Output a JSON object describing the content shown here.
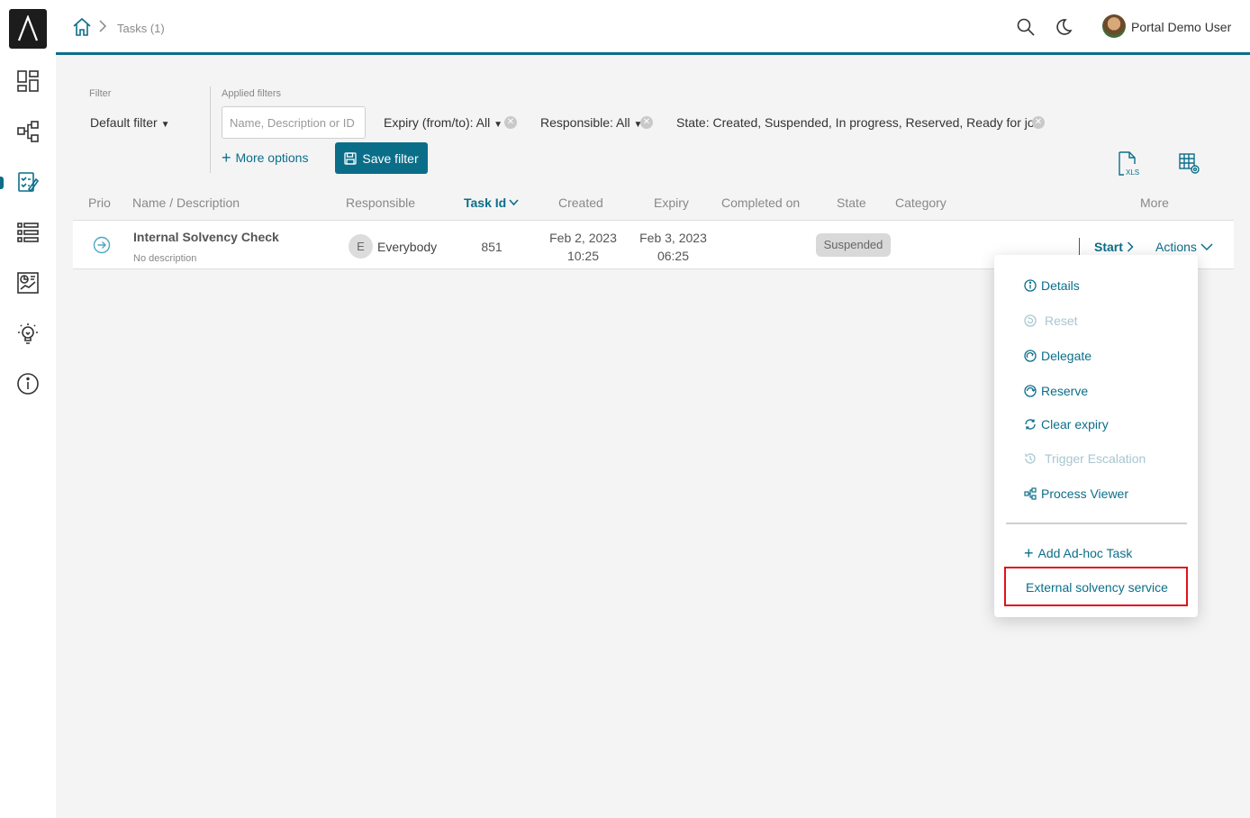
{
  "header": {
    "breadcrumb": "Tasks (1)",
    "user_name": "Portal Demo User"
  },
  "sidebar": {
    "items": [
      {
        "icon": "dashboard-icon"
      },
      {
        "icon": "process-icon"
      },
      {
        "icon": "tasks-icon",
        "active": true
      },
      {
        "icon": "list-icon"
      },
      {
        "icon": "statistics-icon"
      },
      {
        "icon": "lightbulb-icon"
      },
      {
        "icon": "info-icon"
      }
    ]
  },
  "filters": {
    "filter_label": "Filter",
    "filter_value": "Default filter",
    "applied_label": "Applied filters",
    "search_placeholder": "Name, Description or ID",
    "expiry_chip": "Expiry (from/to): All",
    "responsible_chip": "Responsible: All",
    "state_chip": "State: Created, Suspended, In progress, Reserved, Ready for jo",
    "more_options": "More options",
    "save_filter": "Save filter"
  },
  "table": {
    "columns": [
      "Prio",
      "Name / Description",
      "Responsible",
      "Task Id",
      "Created",
      "Expiry",
      "Completed on",
      "State",
      "Category",
      "More"
    ],
    "rows": [
      {
        "name": "Internal Solvency Check",
        "description": "No description",
        "responsible_initial": "E",
        "responsible": "Everybody",
        "task_id": "851",
        "created_date": "Feb 2, 2023",
        "created_time": "10:25",
        "expiry_date": "Feb 3, 2023",
        "expiry_time": "06:25",
        "state": "Suspended",
        "start": "Start",
        "actions": "Actions"
      }
    ]
  },
  "menu": {
    "details": "Details",
    "reset": "Reset",
    "delegate": "Delegate",
    "reserve": "Reserve",
    "clear_expiry": "Clear expiry",
    "trigger_escalation": "Trigger Escalation",
    "process_viewer": "Process Viewer",
    "add_adhoc": "Add Ad-hoc Task",
    "external_solvency": "External solvency service"
  },
  "colors": {
    "accent": "#0b6e89",
    "highlight": "#e0121b"
  }
}
